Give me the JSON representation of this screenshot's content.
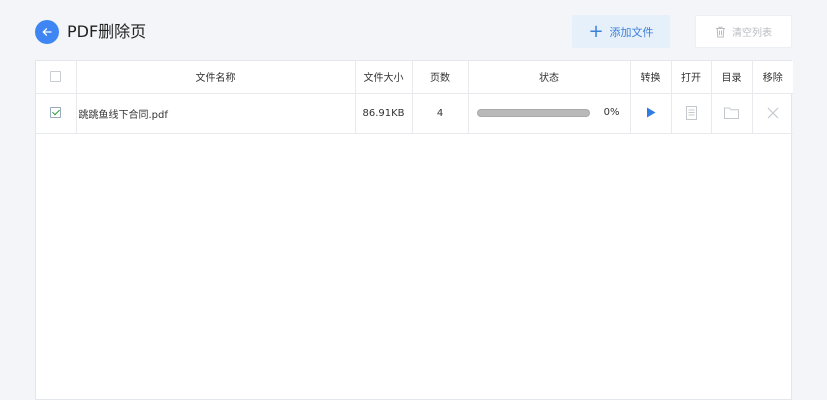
{
  "header": {
    "title": "PDF删除页",
    "add_label": "添加文件",
    "clear_label": "清空列表"
  },
  "table": {
    "columns": {
      "name": "文件名称",
      "size": "文件大小",
      "pages": "页数",
      "status": "状态",
      "convert": "转换",
      "open": "打开",
      "folder": "目录",
      "remove": "移除"
    },
    "rows": [
      {
        "checked": true,
        "name": "跳跳鱼线下合同.pdf",
        "size": "86.91KB",
        "pages": "4",
        "progress_percent": 0,
        "progress_text": "0%"
      }
    ]
  },
  "colors": {
    "accent": "#3f86f4",
    "add_bg": "#e6f0fb",
    "check": "#2a9d3a"
  },
  "icons": {
    "back": "arrow-left-icon",
    "add": "plus-icon",
    "clear": "trash-icon",
    "convert": "play-icon",
    "open": "document-icon",
    "folder": "folder-icon",
    "remove": "close-icon"
  }
}
